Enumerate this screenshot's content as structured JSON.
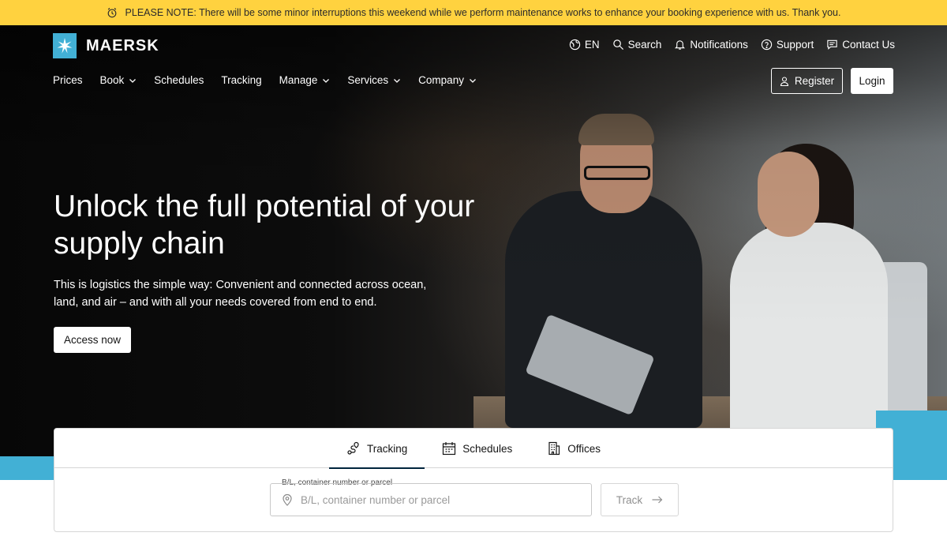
{
  "notice": {
    "icon": "alarm-clock-icon",
    "text": "PLEASE NOTE: There will be some minor interruptions this weekend while we perform maintenance works to enhance your booking experience with us. Thank you."
  },
  "brand": {
    "name": "MAERSK",
    "logo_icon": "star-icon",
    "accent_color": "#42b0d5",
    "banner_color": "#ffd23f"
  },
  "utility_nav": [
    {
      "icon": "globe-icon",
      "label": "EN"
    },
    {
      "icon": "search-icon",
      "label": "Search"
    },
    {
      "icon": "bell-icon",
      "label": "Notifications"
    },
    {
      "icon": "help-icon",
      "label": "Support"
    },
    {
      "icon": "chat-icon",
      "label": "Contact Us"
    }
  ],
  "main_nav": [
    {
      "label": "Prices",
      "dropdown": false
    },
    {
      "label": "Book",
      "dropdown": true
    },
    {
      "label": "Schedules",
      "dropdown": false
    },
    {
      "label": "Tracking",
      "dropdown": false
    },
    {
      "label": "Manage",
      "dropdown": true
    },
    {
      "label": "Services",
      "dropdown": true
    },
    {
      "label": "Company",
      "dropdown": true
    }
  ],
  "auth": {
    "register_label": "Register",
    "login_label": "Login"
  },
  "hero": {
    "title": "Unlock the full potential of your supply chain",
    "subtitle": "This is logistics the simple way: Convenient and connected across ocean, land, and air – and with all your needs covered from end to end.",
    "cta_label": "Access now"
  },
  "panel": {
    "tabs": [
      {
        "icon": "route-pin-icon",
        "label": "Tracking",
        "active": true
      },
      {
        "icon": "calendar-icon",
        "label": "Schedules",
        "active": false
      },
      {
        "icon": "building-icon",
        "label": "Offices",
        "active": false
      }
    ],
    "field_label": "B/L, container number or parcel",
    "field_placeholder": "B/L, container number or parcel",
    "field_value": "",
    "track_label": "Track"
  }
}
